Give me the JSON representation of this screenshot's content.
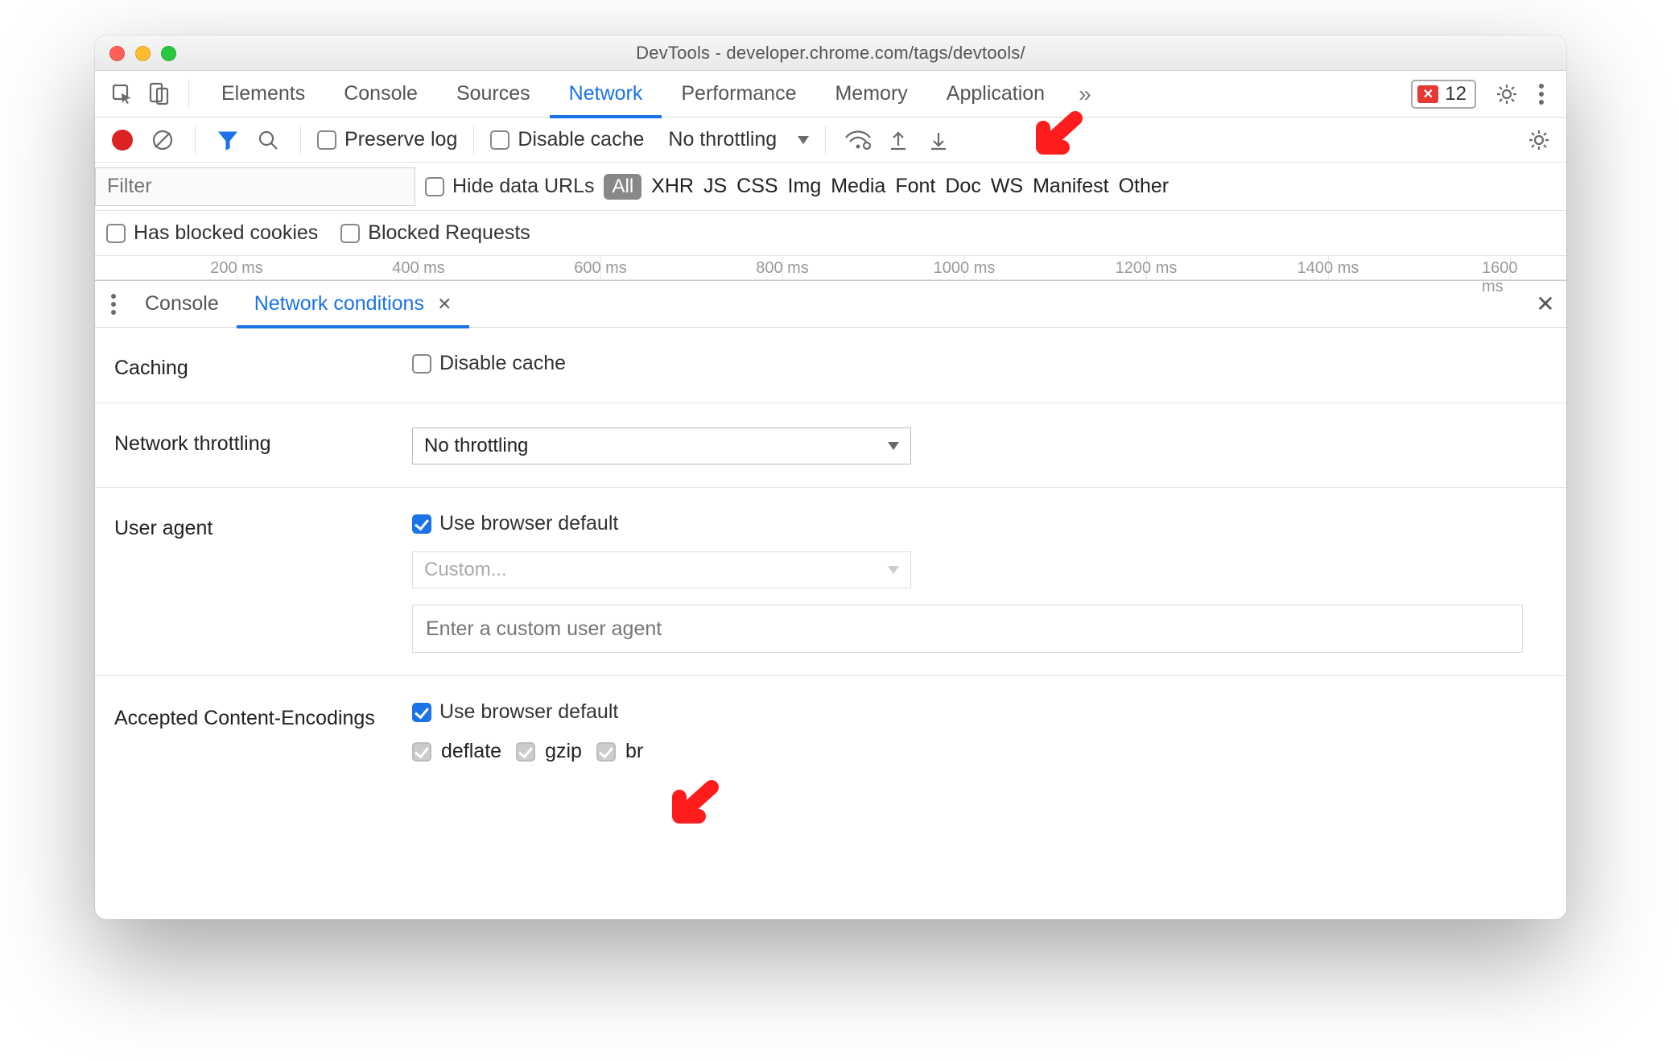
{
  "window": {
    "title": "DevTools - developer.chrome.com/tags/devtools/"
  },
  "tabs": {
    "items": [
      "Elements",
      "Console",
      "Sources",
      "Network",
      "Performance",
      "Memory",
      "Application"
    ],
    "active": "Network",
    "overflow_glyph": "»",
    "error_count": "12"
  },
  "toolbar": {
    "preserve_log": "Preserve log",
    "disable_cache": "Disable cache",
    "throttling": "No throttling"
  },
  "filter": {
    "placeholder": "Filter",
    "hide_data_urls": "Hide data URLs",
    "all": "All",
    "types": [
      "XHR",
      "JS",
      "CSS",
      "Img",
      "Media",
      "Font",
      "Doc",
      "WS",
      "Manifest",
      "Other"
    ]
  },
  "cookies": {
    "blocked_cookies": "Has blocked cookies",
    "blocked_requests": "Blocked Requests"
  },
  "timeline": {
    "ticks": [
      "200 ms",
      "400 ms",
      "600 ms",
      "800 ms",
      "1000 ms",
      "1200 ms",
      "1400 ms",
      "1600 ms"
    ]
  },
  "drawer": {
    "tabs": {
      "console": "Console",
      "network_conditions": "Network conditions"
    }
  },
  "nc": {
    "caching_label": "Caching",
    "disable_cache": "Disable cache",
    "throttling_label": "Network throttling",
    "throttling_value": "No throttling",
    "ua_label": "User agent",
    "ua_use_default": "Use browser default",
    "ua_custom": "Custom...",
    "ua_placeholder": "Enter a custom user agent",
    "enc_label": "Accepted Content-Encodings",
    "enc_use_default": "Use browser default",
    "enc_deflate": "deflate",
    "enc_gzip": "gzip",
    "enc_br": "br"
  }
}
